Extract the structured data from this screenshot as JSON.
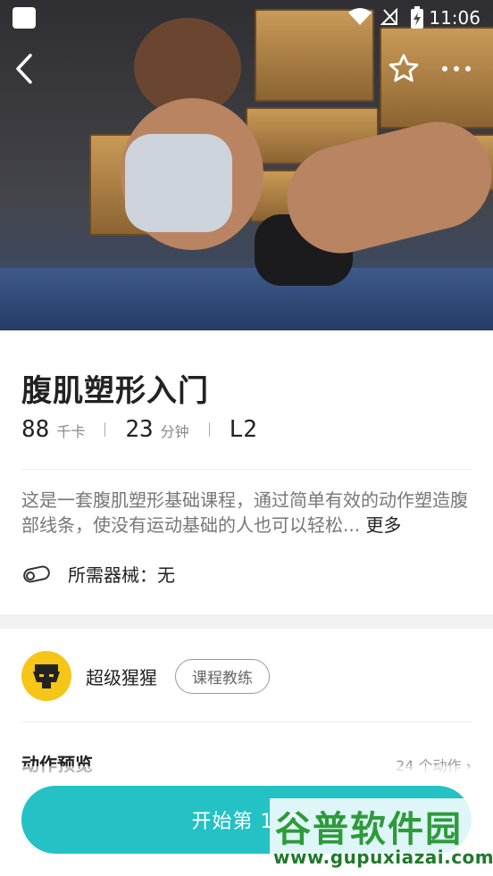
{
  "status_bar": {
    "time": "11:06"
  },
  "course": {
    "title": "腹肌塑形入门",
    "calories": "88",
    "calories_unit": "千卡",
    "duration": "23",
    "duration_unit": "分钟",
    "level": "L2",
    "description": "这是一套腹肌塑形基础课程，通过简单有效的动作塑造腹部线条，使没有运动基础的人也可以轻松...",
    "more_label": "更多",
    "equipment_label": "所需器械：无"
  },
  "coach": {
    "name": "超级猩猩",
    "tag": "课程教练"
  },
  "preview": {
    "title": "动作预览",
    "count": "24 个动作"
  },
  "start_button": {
    "label": "开始第 1 次"
  },
  "watermark": {
    "title": "谷普软件园",
    "url": "www.gupuxiazai.com"
  },
  "colors": {
    "accent": "#24c1c5",
    "coach_avatar": "#f5c518",
    "watermark": "#2e9a3a"
  },
  "icons": [
    "back-icon",
    "star-icon",
    "more-icon",
    "equipment-icon",
    "wifi-icon",
    "battery-icon"
  ]
}
